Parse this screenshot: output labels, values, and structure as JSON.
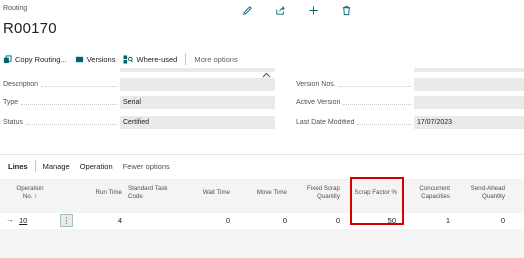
{
  "page": {
    "breadcrumb": "Routing",
    "title": "R00170"
  },
  "top_actions": [
    "edit-icon",
    "share-icon",
    "add-icon",
    "delete-icon"
  ],
  "action_bar": {
    "copy_routing": "Copy Routing...",
    "versions": "Versions",
    "where_used": "Where-used",
    "more_options": "More options"
  },
  "fields": {
    "description": {
      "label": "Description",
      "value": ""
    },
    "type": {
      "label": "Type",
      "value": "Serial"
    },
    "status": {
      "label": "Status",
      "value": "Certified"
    },
    "version_nos": {
      "label": "Version Nos.",
      "value": ""
    },
    "active_version": {
      "label": "Active Version",
      "value": ""
    },
    "last_date_modified": {
      "label": "Last Date Modified",
      "value": "17/07/2023"
    }
  },
  "lines": {
    "title": "Lines",
    "manage": "Manage",
    "operation": "Operation",
    "fewer_options": "Fewer options",
    "columns": {
      "operation_no": "Operation No. ↑",
      "run_time": "Run Time",
      "standard_task_code": "Standard Task Code",
      "wait_time": "Wait Time",
      "move_time": "Move Time",
      "fixed_scrap_quantity": "Fixed Scrap Quantity",
      "scrap_factor": "Scrap Factor %",
      "concurrent_capacities": "Concurrent Capacities",
      "send_ahead_quantity": "Send-Ahead Quantity"
    },
    "rows": [
      {
        "operation_no": "10",
        "run_time": "4",
        "standard_task_code": "",
        "wait_time": "0",
        "move_time": "0",
        "fixed_scrap_quantity": "0",
        "scrap_factor": "50",
        "concurrent_capacities": "1",
        "send_ahead_quantity": "0"
      }
    ]
  },
  "colors": {
    "accent": "#00646e",
    "highlight_border": "#d40000",
    "field_bg": "#eaeaea"
  }
}
